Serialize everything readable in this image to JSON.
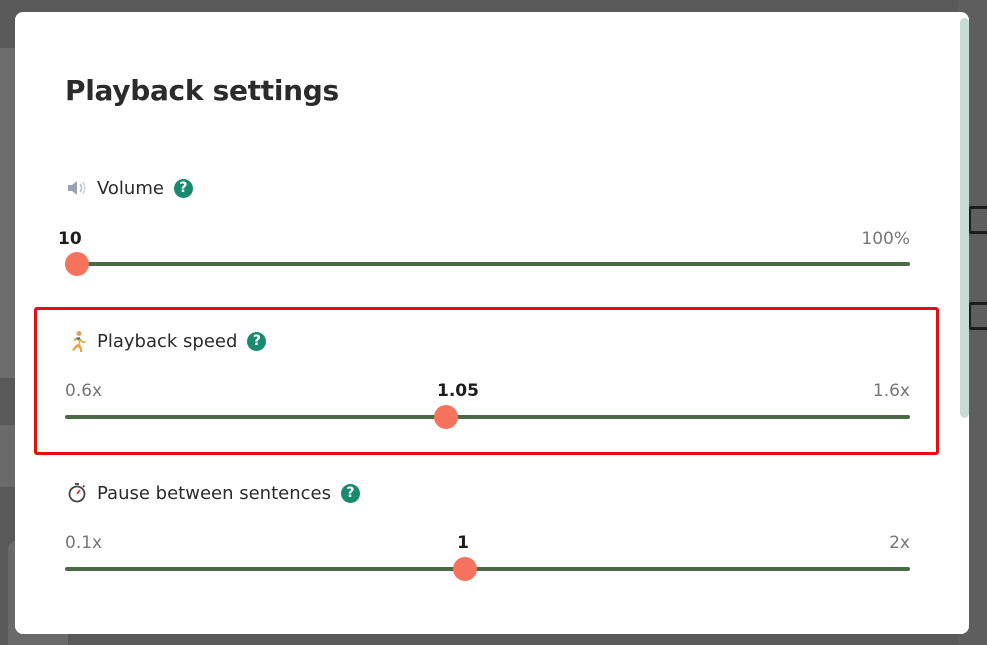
{
  "modal": {
    "title": "Playback settings"
  },
  "settings": [
    {
      "id": "volume",
      "icon": "speaker-icon",
      "label": "Volume",
      "help": "?",
      "min_label": "",
      "max_label": "100%",
      "current_label": "10",
      "fraction": 0.0
    },
    {
      "id": "playback-speed",
      "icon": "running-person-icon",
      "label": "Playback speed",
      "help": "?",
      "min_label": "0.6x",
      "max_label": "1.6x",
      "current_label": "1.05",
      "fraction": 0.45
    },
    {
      "id": "pause",
      "icon": "stopwatch-icon",
      "label": "Pause between sentences",
      "help": "?",
      "min_label": "0.1x",
      "max_label": "2x",
      "current_label": "1",
      "fraction": 0.474
    }
  ],
  "colors": {
    "accent": "#f7735d",
    "track": "#4a6a45",
    "help": "#1a8a6e",
    "highlight": "#e01010"
  }
}
